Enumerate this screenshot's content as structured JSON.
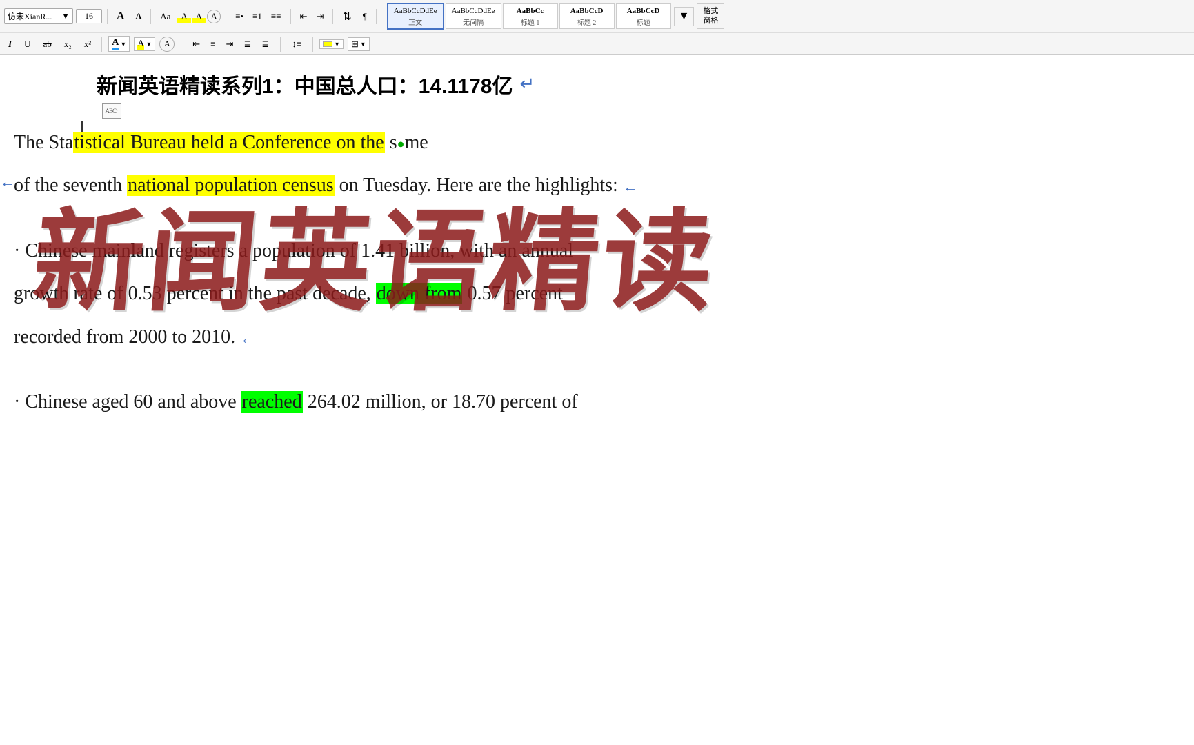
{
  "toolbar": {
    "font_name": "仿宋XiаnR...",
    "font_size": "16",
    "font_size_increase": "A",
    "font_size_decrease": "A",
    "clear_format": "Aa",
    "row1_buttons": [
      "Aa",
      "A",
      "A",
      "A"
    ],
    "style_presets": [
      {
        "id": "zhengwen",
        "preview": "AaBbCcDdEe",
        "label": "正文",
        "active": true
      },
      {
        "id": "wujiange",
        "preview": "AaBbCcDdEe",
        "label": "无间隔"
      },
      {
        "id": "biaoti1",
        "preview": "AaBbCc",
        "label": "标题 1"
      },
      {
        "id": "biaoti2",
        "preview": "AaBbCcD",
        "label": "标题 2"
      },
      {
        "id": "biaoti",
        "preview": "AaBbCcD",
        "label": "标题"
      }
    ],
    "more_styles": "▼",
    "format_style_label": "格式\n窗格",
    "row2_italic": "I",
    "row2_underline": "U",
    "row2_strikethrough": "ab",
    "row2_subscript": "x₂",
    "row2_superscript": "x²",
    "text_color_A": "A",
    "highlight_color_A": "A",
    "circle_btn": "⊙",
    "align_left": "≡",
    "align_center": "≡",
    "align_right": "≡",
    "align_justify": "≡",
    "align_distribute": "≡",
    "line_spacing": "≡",
    "bullet_list": "☰",
    "number_list": "☰",
    "decrease_indent": "⇤",
    "increase_indent": "⇥",
    "sort": "↕",
    "show_hide": "¶",
    "shading_label": "▼",
    "border_label": "▼"
  },
  "document": {
    "title": "新闻英语精读系列1：中国总人口：14.1178亿",
    "enter_mark": "↵",
    "watermark_text": "新闻英语精读",
    "lines": [
      {
        "id": "line1",
        "text_before_highlight": "The Sta",
        "highlight_yellow": "tistical Bureau held a Conference on the",
        "text_after_highlight": " same",
        "has_enter": false,
        "has_left_bracket": false
      },
      {
        "id": "line2",
        "text_before": "of the seventh ",
        "highlight_yellow": "national population census",
        "text_after": " on Tuesday. Here are the highlights:",
        "has_enter": true,
        "has_left_bracket": true
      },
      {
        "id": "line3",
        "text": "· Chinese mainland registers a population of 1.41 billion, with an annual",
        "has_enter": false
      },
      {
        "id": "line4",
        "text_before": "growth rate of 0.53 percent in the past decade, ",
        "highlight_green": "down from",
        "text_after": " 0.57 percent",
        "has_enter": false
      },
      {
        "id": "line5",
        "text": "recorded from 2000 to 2010.",
        "has_enter": true
      },
      {
        "id": "line6",
        "text_before": "· Chinese aged 60 and above ",
        "highlight_green": "reached",
        "text_after": " 264.02 million, or 18.70 percent of",
        "has_enter": false
      }
    ]
  }
}
